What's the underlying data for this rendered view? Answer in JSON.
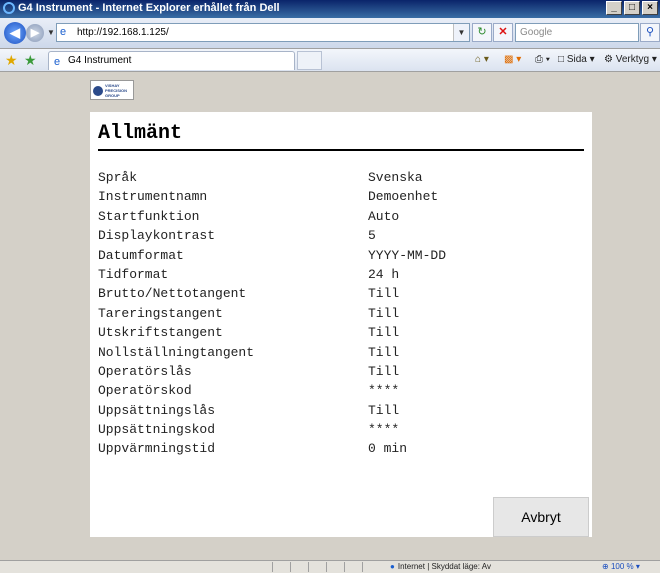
{
  "window": {
    "title": "G4 Instrument - Internet Explorer erhållet från Dell",
    "minimize": "_",
    "maximize": "□",
    "close": "×"
  },
  "address_bar": {
    "url": "http://192.168.1.125/",
    "search_placeholder": "Google"
  },
  "tabs": [
    {
      "label": "G4 Instrument"
    }
  ],
  "command_bar": {
    "page_label": "Sida",
    "tools_label": "Verktyg"
  },
  "logo": {
    "text": "VISHAY PRECISION GROUP"
  },
  "page": {
    "title": "Allmänt",
    "settings": [
      {
        "key": "Språk",
        "value": "Svenska"
      },
      {
        "key": "Instrumentnamn",
        "value": "Demoenhet"
      },
      {
        "key": "Startfunktion",
        "value": "Auto"
      },
      {
        "key": "Displaykontrast",
        "value": "5"
      },
      {
        "key": "Datumformat",
        "value": "YYYY-MM-DD"
      },
      {
        "key": "Tidformat",
        "value": "24 h"
      },
      {
        "key": "Brutto/Nettotangent",
        "value": "Till"
      },
      {
        "key": "Tareringstangent",
        "value": "Till"
      },
      {
        "key": "Utskriftstangent",
        "value": "Till"
      },
      {
        "key": "Nollställningtangent",
        "value": "Till"
      },
      {
        "key": "Operatörslås",
        "value": "Till"
      },
      {
        "key": "Operatörskod",
        "value": "****"
      },
      {
        "key": "Uppsättningslås",
        "value": "Till"
      },
      {
        "key": "Uppsättningskod",
        "value": "****"
      },
      {
        "key": "Uppvärmningstid",
        "value": "0 min"
      }
    ],
    "cancel_label": "Avbryt"
  },
  "status_bar": {
    "zone": "Internet | Skyddat läge: Av",
    "zoom": "100 %"
  }
}
